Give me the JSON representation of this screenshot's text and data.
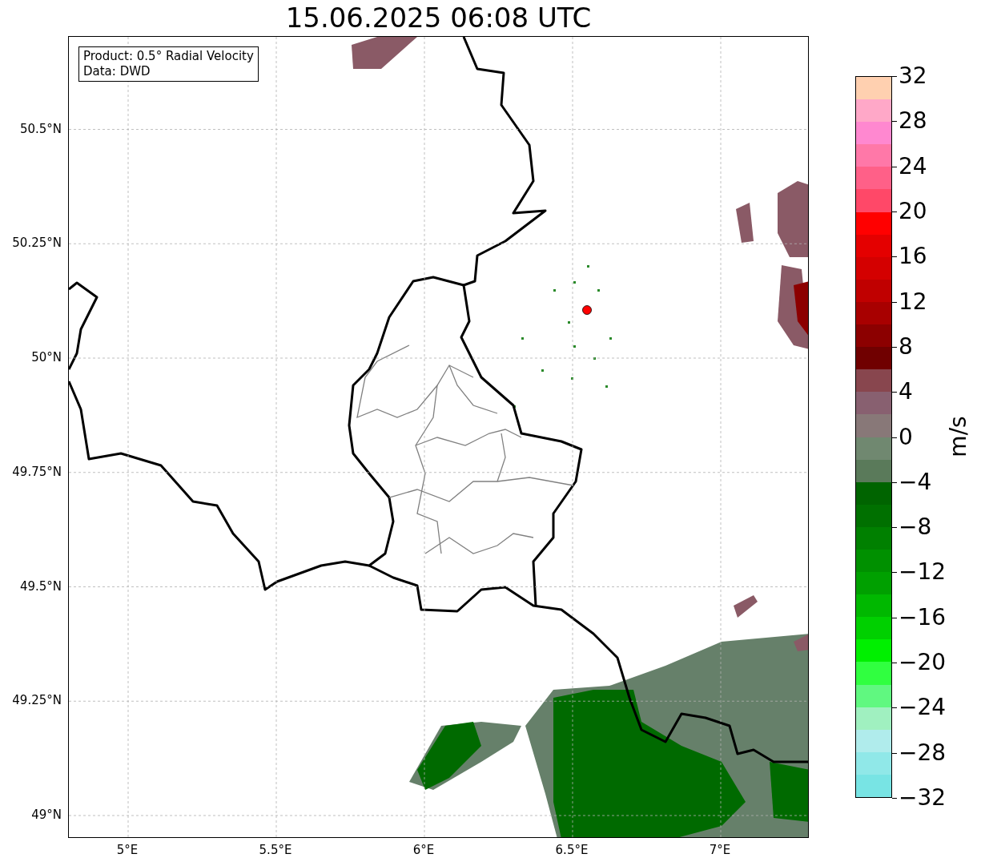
{
  "title": "15.06.2025 06:08 UTC",
  "info_box": [
    "Product: 0.5° Radial Velocity",
    "Data: DWD"
  ],
  "map": {
    "lon_ticks": [
      "5°E",
      "5.5°E",
      "6°E",
      "6.5°E",
      "7°E"
    ],
    "lat_ticks": [
      "50.5°N",
      "50.25°N",
      "50°N",
      "49.75°N",
      "49.5°N",
      "49.25°N",
      "49°N"
    ]
  },
  "colorbar": {
    "label": "m/s",
    "ticks": [
      "32",
      "28",
      "24",
      "20",
      "16",
      "12",
      "8",
      "4",
      "0",
      "−4",
      "−8",
      "−12",
      "−16",
      "−20",
      "−24",
      "−28",
      "−32"
    ],
    "segments": [
      {
        "color": "#ffd0b0"
      },
      {
        "color": "#ffa8c8"
      },
      {
        "color": "#ff88d0"
      },
      {
        "color": "#ff78a8"
      },
      {
        "color": "#ff6088"
      },
      {
        "color": "#ff4868"
      },
      {
        "color": "#ff0000"
      },
      {
        "color": "#e40000"
      },
      {
        "color": "#d40000"
      },
      {
        "color": "#c00000"
      },
      {
        "color": "#a80000"
      },
      {
        "color": "#8c0000"
      },
      {
        "color": "#700000"
      },
      {
        "color": "#88464e"
      },
      {
        "color": "#886070"
      },
      {
        "color": "#887878"
      },
      {
        "color": "#708870"
      },
      {
        "color": "#5a7a5a"
      },
      {
        "color": "#006400"
      },
      {
        "color": "#007000"
      },
      {
        "color": "#008000"
      },
      {
        "color": "#009000"
      },
      {
        "color": "#00a000"
      },
      {
        "color": "#00b800"
      },
      {
        "color": "#00d000"
      },
      {
        "color": "#00f000"
      },
      {
        "color": "#30ff40"
      },
      {
        "color": "#60f880"
      },
      {
        "color": "#a0f0c0"
      },
      {
        "color": "#b0ecec"
      },
      {
        "color": "#90e8e8"
      },
      {
        "color": "#78e4e4"
      }
    ]
  }
}
